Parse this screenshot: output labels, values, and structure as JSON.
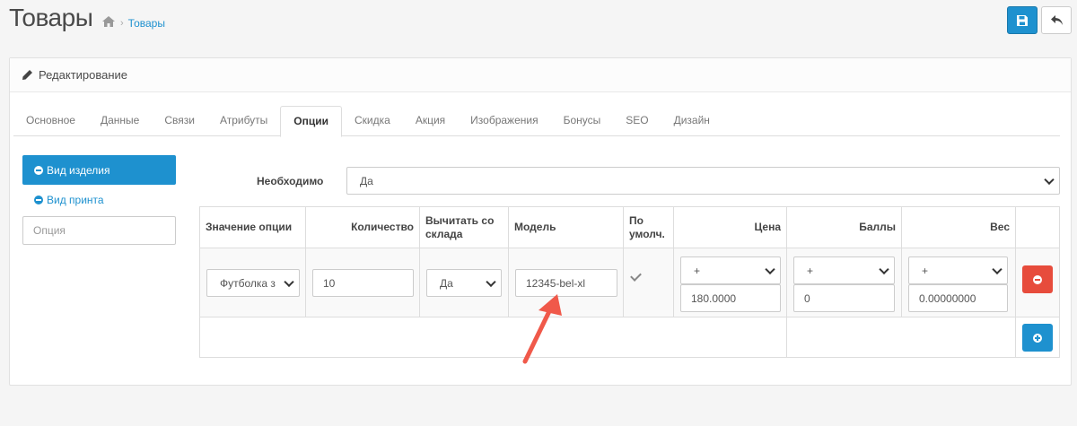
{
  "header": {
    "title": "Товары",
    "breadcrumb": [
      {
        "label": "Товары"
      }
    ]
  },
  "panel": {
    "title": "Редактирование"
  },
  "tabs": [
    {
      "label": "Основное"
    },
    {
      "label": "Данные"
    },
    {
      "label": "Связи"
    },
    {
      "label": "Атрибуты"
    },
    {
      "label": "Опции",
      "active": true
    },
    {
      "label": "Скидка"
    },
    {
      "label": "Акция"
    },
    {
      "label": "Изображения"
    },
    {
      "label": "Бонусы"
    },
    {
      "label": "SEO"
    },
    {
      "label": "Дизайн"
    }
  ],
  "options_sidebar": {
    "items": [
      {
        "label": "Вид изделия"
      },
      {
        "label": "Вид принта"
      }
    ],
    "input_placeholder": "Опция"
  },
  "required": {
    "label": "Необходимо",
    "value": "Да"
  },
  "table": {
    "headers": {
      "option_value": "Значение опции",
      "quantity": "Количество",
      "subtract_line1": "Вычитать со",
      "subtract_line2": "склада",
      "model": "Модель",
      "default_line1": "По",
      "default_line2": "умолч.",
      "price": "Цена",
      "points": "Баллы",
      "weight": "Вес"
    },
    "row": {
      "option_value": "Футболка з",
      "quantity": "10",
      "subtract": "Да",
      "model": "12345-bel-xl",
      "price_prefix": "+",
      "price": "180.0000",
      "points_prefix": "+",
      "points": "0",
      "weight_prefix": "+",
      "weight": "0.00000000"
    }
  },
  "colors": {
    "primary": "#1e91cf",
    "danger": "#e74c3c",
    "arrow": "#f0594a"
  }
}
